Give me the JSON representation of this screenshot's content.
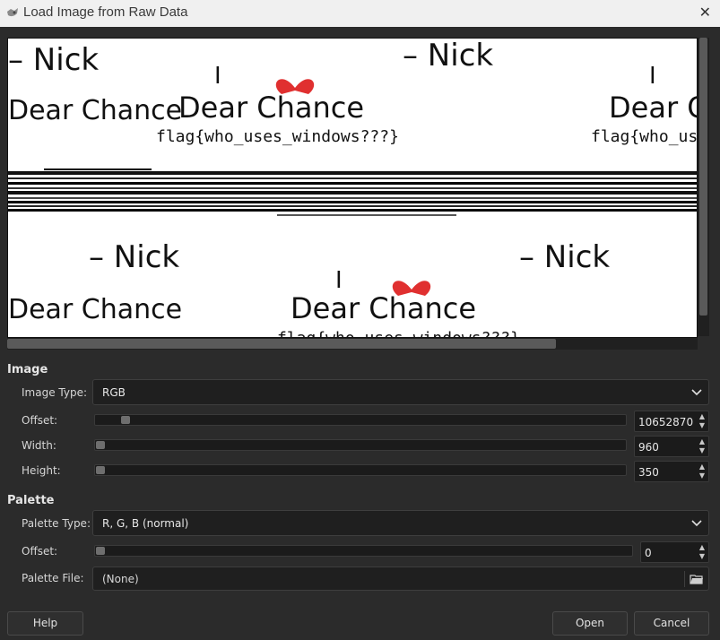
{
  "window": {
    "title": "Load Image from Raw Data",
    "close_glyph": "✕"
  },
  "preview": {
    "lines": {
      "name": "– Nick",
      "greeting": "Dear Chance",
      "pronoun": "I",
      "flag": "flag{who_uses_windows???}"
    },
    "heart_color": "#e03030"
  },
  "image_section": {
    "title": "Image",
    "image_type_label": "Image Type:",
    "image_type_value": "RGB",
    "offset_label": "Offset:",
    "offset_value": "10652870",
    "width_label": "Width:",
    "width_value": "960",
    "height_label": "Height:",
    "height_value": "350"
  },
  "palette_section": {
    "title": "Palette",
    "palette_type_label": "Palette Type:",
    "palette_type_value": "R, G, B (normal)",
    "offset_label": "Offset:",
    "offset_value": "0",
    "palette_file_label": "Palette File:",
    "palette_file_value": "(None)"
  },
  "buttons": {
    "help": "Help",
    "open": "Open",
    "cancel": "Cancel"
  },
  "icons": {
    "app": "gimp-wilber-icon",
    "dropdown": "chevron-down-icon",
    "file": "folder-open-icon"
  }
}
